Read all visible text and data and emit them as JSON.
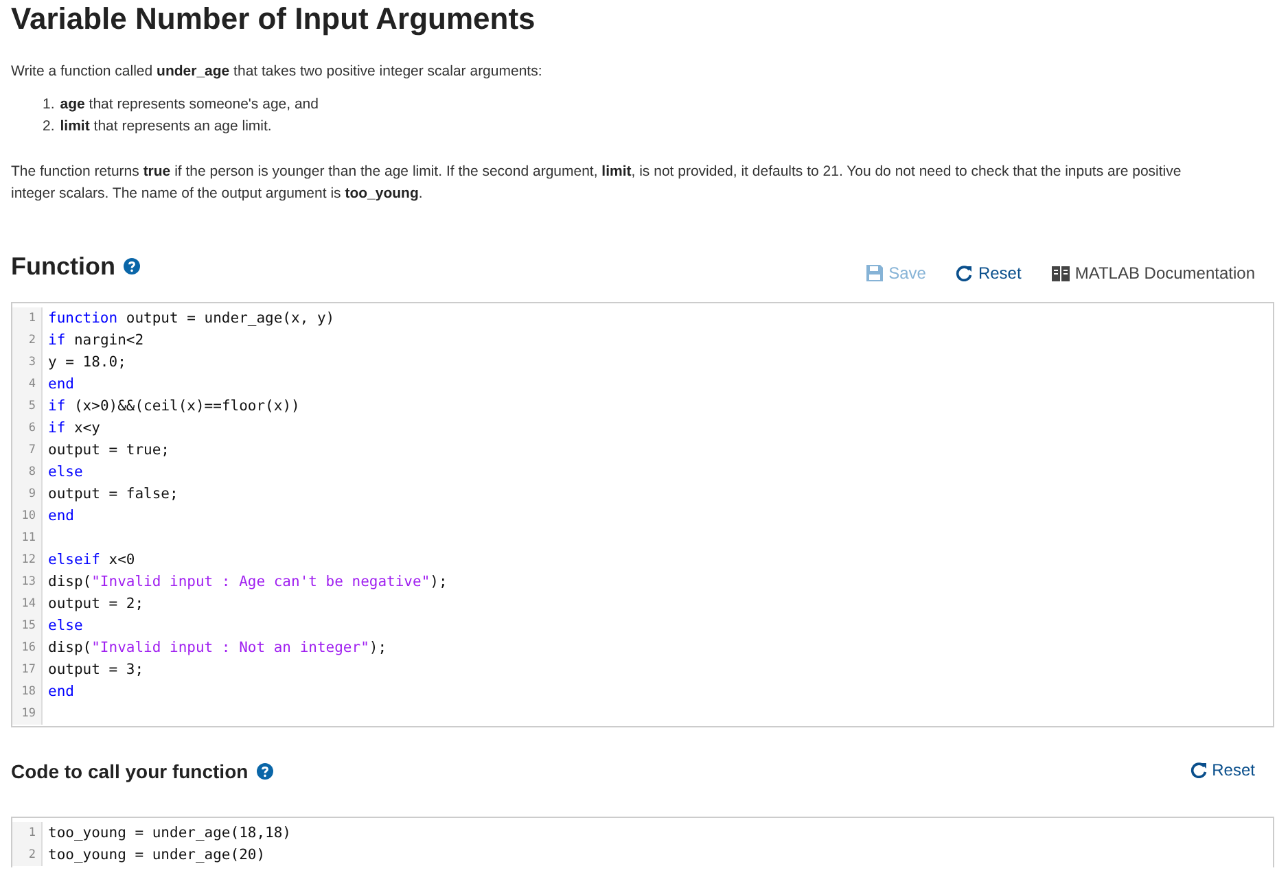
{
  "title": "Variable Number of Input Arguments",
  "intro": "Write a function called **under_age** that takes two positive integer scalar arguments:",
  "list": [
    {
      "number": "1.",
      "text": "**age** that represents someone's age, and"
    },
    {
      "number": "2.",
      "text": "**limit** that represents an age limit."
    }
  ],
  "description": "The function returns **true** if the person is younger than the age limit. If the second argument, **limit**, is not provided, it defaults to 21. You do not need to check that the inputs are positive integer scalars. The name of the output argument is **too_young**.",
  "function_section": {
    "heading": "Function",
    "toolbar": [
      {
        "kind": "save",
        "label": "Save",
        "disabled": true
      },
      {
        "kind": "reset",
        "label": "Reset"
      },
      {
        "kind": "docs",
        "label": "MATLAB Documentation"
      }
    ],
    "code": [
      {
        "number": "1",
        "tokens": [
          {
            "kind": "keyword",
            "text": "function"
          },
          {
            "kind": "plain",
            "text": " output = under_age(x, y)"
          }
        ]
      },
      {
        "number": "2",
        "tokens": [
          {
            "kind": "keyword",
            "text": "if"
          },
          {
            "kind": "plain",
            "text": " nargin<2"
          }
        ]
      },
      {
        "number": "3",
        "tokens": [
          {
            "kind": "plain",
            "text": "y = 18.0;"
          }
        ]
      },
      {
        "number": "4",
        "tokens": [
          {
            "kind": "keyword",
            "text": "end"
          }
        ]
      },
      {
        "number": "5",
        "tokens": [
          {
            "kind": "keyword",
            "text": "if"
          },
          {
            "kind": "plain",
            "text": " (x>0)&&(ceil(x)==floor(x))"
          }
        ]
      },
      {
        "number": "6",
        "tokens": [
          {
            "kind": "keyword",
            "text": "if"
          },
          {
            "kind": "plain",
            "text": " x<y"
          }
        ]
      },
      {
        "number": "7",
        "tokens": [
          {
            "kind": "plain",
            "text": "output = true;"
          }
        ]
      },
      {
        "number": "8",
        "tokens": [
          {
            "kind": "keyword",
            "text": "else"
          }
        ]
      },
      {
        "number": "9",
        "tokens": [
          {
            "kind": "plain",
            "text": "output = false;"
          }
        ]
      },
      {
        "number": "10",
        "tokens": [
          {
            "kind": "keyword",
            "text": "end"
          }
        ]
      },
      {
        "number": "11"
      },
      {
        "number": "12",
        "tokens": [
          {
            "kind": "keyword",
            "text": "elseif"
          },
          {
            "kind": "plain",
            "text": " x<0"
          }
        ]
      },
      {
        "number": "13",
        "tokens": [
          {
            "kind": "plain",
            "text": "disp("
          },
          {
            "kind": "string",
            "text": "\"Invalid input : Age can't be negative\""
          },
          {
            "kind": "plain",
            "text": ");"
          }
        ]
      },
      {
        "number": "14",
        "tokens": [
          {
            "kind": "plain",
            "text": "output = 2;"
          }
        ]
      },
      {
        "number": "15",
        "tokens": [
          {
            "kind": "keyword",
            "text": "else"
          }
        ]
      },
      {
        "number": "16",
        "tokens": [
          {
            "kind": "plain",
            "text": "disp("
          },
          {
            "kind": "string",
            "text": "\"Invalid input : Not an integer\""
          },
          {
            "kind": "plain",
            "text": ");"
          }
        ]
      },
      {
        "number": "17",
        "tokens": [
          {
            "kind": "plain",
            "text": "output = 3;"
          }
        ]
      },
      {
        "number": "18",
        "tokens": [
          {
            "kind": "keyword",
            "text": "end"
          }
        ]
      },
      {
        "number": "19"
      }
    ]
  },
  "call_section": {
    "heading": "Code to call your function",
    "toolbar": [
      {
        "kind": "reset",
        "label": "Reset"
      }
    ],
    "code": [
      {
        "number": "1",
        "tokens": [
          {
            "kind": "plain",
            "text": "too_young = under_age(18,18)"
          }
        ]
      },
      {
        "number": "2",
        "tokens": [
          {
            "kind": "plain",
            "text": "too_young = under_age(20)"
          }
        ]
      }
    ]
  }
}
